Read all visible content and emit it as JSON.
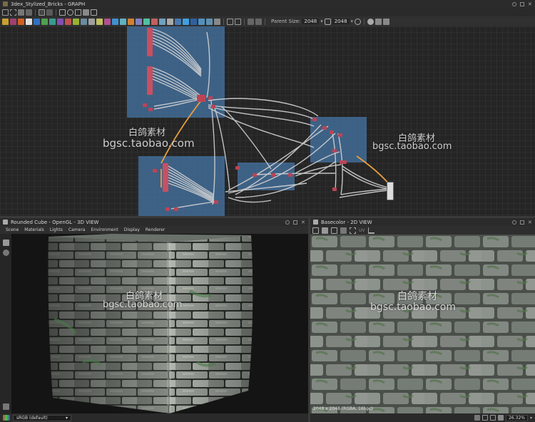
{
  "graph": {
    "title": "3dex_Stylized_Bricks - GRAPH",
    "parent_size_label": "Parent Size:",
    "parent_size_value": "2048",
    "output_size_value": "2048"
  },
  "view3d": {
    "title": "Rounded Cube - OpenGL - 3D VIEW",
    "menu": [
      "Scene",
      "Materials",
      "Lights",
      "Camera",
      "Environment",
      "Display",
      "Renderer"
    ],
    "colorspace": "sRGB (default)"
  },
  "view2d": {
    "title": "Basecolor - 2D VIEW",
    "uv_label": "UV",
    "info": "2048 x 2048 (RGBA, 16bpc)",
    "zoom": "26.32%"
  },
  "watermark": {
    "cn": "白鸽素材",
    "url": "bgsc.taobao.com"
  },
  "colors": {
    "frame": "#4678aa",
    "wire": "#d0d0d0",
    "wire_highlight": "#e8a040",
    "node": "#bb4455",
    "panel_bg": "#1e1e1e"
  }
}
